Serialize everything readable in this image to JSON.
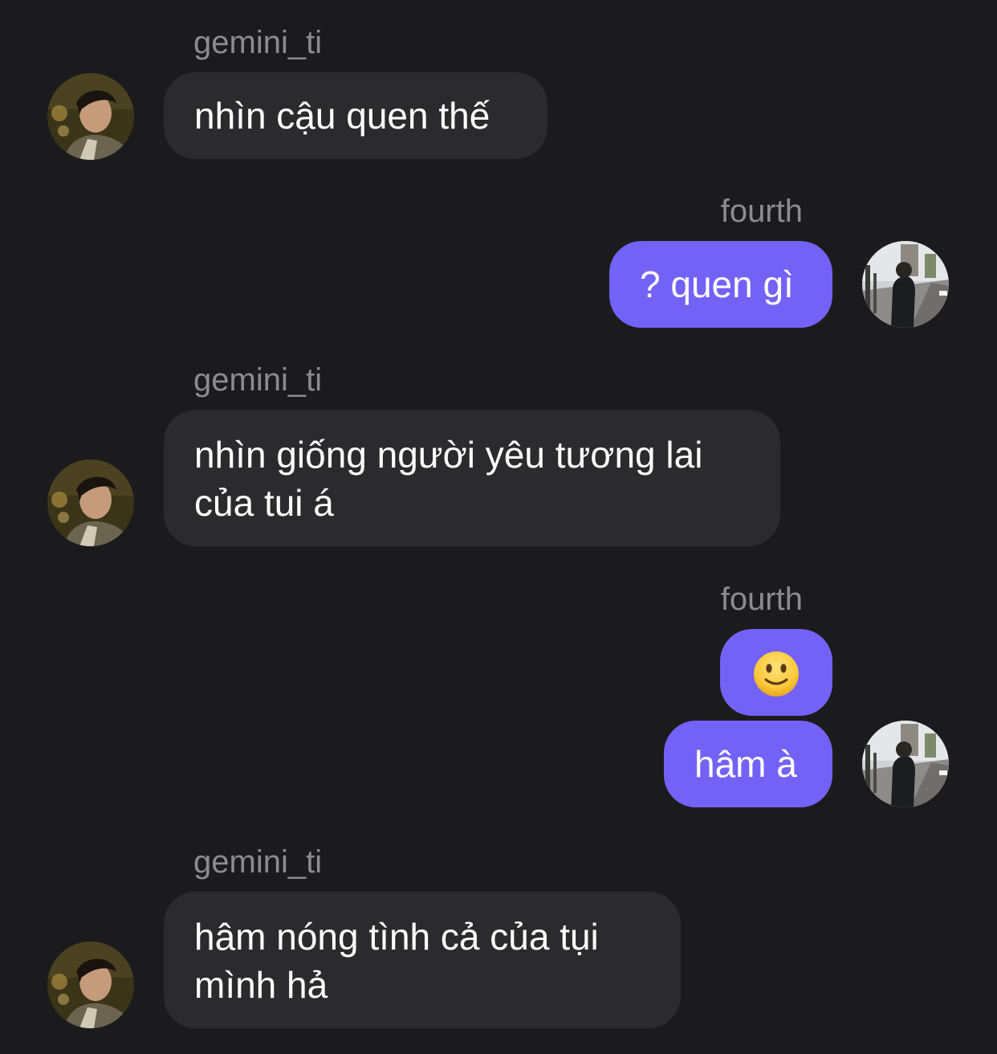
{
  "messages": [
    {
      "sender": "gemini_ti",
      "direction": "incoming",
      "text": "nhìn cậu quen thế"
    },
    {
      "sender": "fourth",
      "direction": "outgoing",
      "text": "? quen gì"
    },
    {
      "sender": "gemini_ti",
      "direction": "incoming",
      "lines": [
        "nhìn giống người yêu tương lai",
        "của tui á"
      ]
    },
    {
      "sender": "fourth",
      "direction": "outgoing",
      "emoji": "slightly-smiling-face-icon"
    },
    {
      "direction": "outgoing",
      "text": "hâm à"
    },
    {
      "sender": "gemini_ti",
      "direction": "incoming",
      "lines": [
        "hâm nóng tình cả của tụi",
        "mình hả"
      ]
    }
  ],
  "colors": {
    "background": "#1b1b1d",
    "incoming_bubble": "#2b2b2e",
    "outgoing_bubble": "#7362f6",
    "sender_name": "#8b8b91",
    "message_text": "#ffffff"
  }
}
